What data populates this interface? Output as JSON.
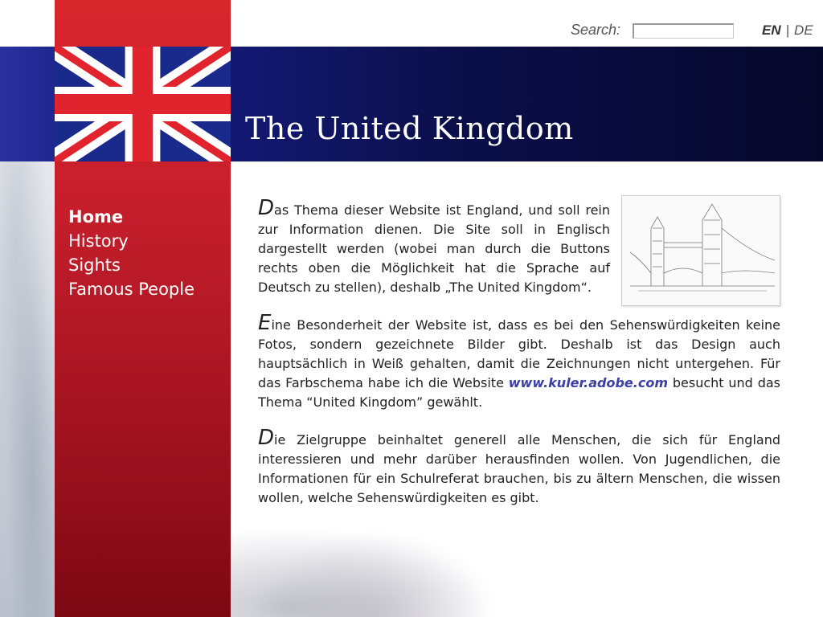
{
  "header": {
    "title": "The United Kingdom",
    "search_label": "Search:",
    "search_value": "",
    "languages": [
      {
        "label": "EN",
        "active": true
      },
      {
        "label": "DE",
        "active": false
      }
    ],
    "lang_separator": "|"
  },
  "nav": {
    "items": [
      {
        "label": "Home",
        "active": true
      },
      {
        "label": "History",
        "active": false
      },
      {
        "label": "Sights",
        "active": false
      },
      {
        "label": "Famous People",
        "active": false
      }
    ]
  },
  "content": {
    "p1_cap": "D",
    "p1": "as Thema dieser Website ist England, und soll rein zur Information dienen. Die Site soll in Englisch dargestellt werden (wobei man durch die Buttons rechts oben die Möglichkeit hat die Sprache auf Deutsch zu stellen), deshalb „The United Kingdom“.",
    "p2_cap": "E",
    "p2_a": "ine Besonderheit der Website ist, dass es bei den Sehenswürdigkeiten keine Fotos, sondern gezeichnete Bilder gibt. Deshalb ist das Design auch hauptsächlich in Weiß gehalten, damit die Zeichnungen nicht untergehen. Für das Farbschema habe ich die Website ",
    "p2_link": "www.kuler.adobe.com",
    "p2_b": " besucht und das Thema “United Kingdom” gewählt.",
    "p3_cap": "D",
    "p3": "ie Zielgruppe beinhaltet generell alle Menschen, die sich für England interessieren und mehr darüber herausfinden wollen. Von Jugendlichen, die Informationen für ein Schulreferat brauchen, bis zu ältern Menschen, die wissen wollen, welche Sehenswürdigkeiten es gibt."
  },
  "figure": {
    "icon": "tower-bridge-sketch"
  },
  "colors": {
    "red": "#c41e2b",
    "navy": "#0b0f4a",
    "link": "#3b3fa6"
  }
}
